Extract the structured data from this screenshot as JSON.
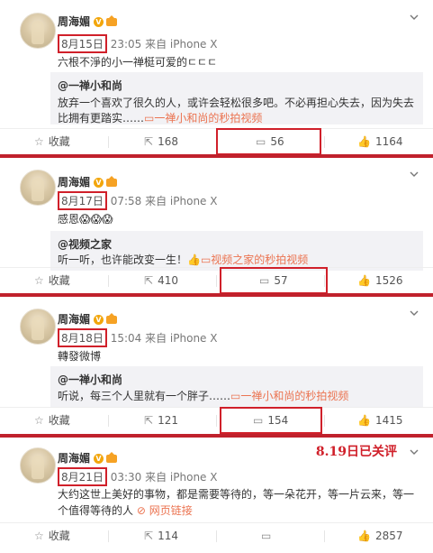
{
  "posts": [
    {
      "author": "周海媚",
      "date": "8月15日",
      "time_source": " 23:05 来自 iPhone X",
      "text": "六根不淨的小一禅梃可爱的ㄷㄷㄷ",
      "repost_author": "@一禅小和尚",
      "repost_text_1": "放弃一个喜欢了很久的人，或许会轻松很多吧。不必再担心失去，因为失去",
      "repost_text_2": "比拥有更踏实……",
      "repost_link": "一禅小和尚的秒拍视频",
      "favorite_label": "收藏",
      "repost_count": "168",
      "comment_count": "56",
      "like_count": "1164"
    },
    {
      "author": "周海媚",
      "date": "8月17日",
      "time_source": " 07:58 来自 iPhone X",
      "text": "感恩😱😱😱",
      "repost_author": "@视频之家",
      "repost_text_1": "听一听，也许能改变一生！👍",
      "repost_link": "视频之家的秒拍视频",
      "favorite_label": "收藏",
      "repost_count": "410",
      "comment_count": "57",
      "like_count": "1526"
    },
    {
      "author": "周海媚",
      "date": "8月18日",
      "time_source": " 15:04 来自 iPhone X",
      "text": "轉發微博",
      "repost_author": "@一禅小和尚",
      "repost_text_1": "听说，每三个人里就有一个胖子……",
      "repost_link": "一禅小和尚的秒拍视频",
      "favorite_label": "收藏",
      "repost_count": "121",
      "comment_count": "154",
      "like_count": "1415"
    },
    {
      "author": "周海媚",
      "date": "8月21日",
      "time_source": " 03:30 来自 iPhone X",
      "text_1": "大约这世上美好的事物，都是需要等待的，等一朵花开，等一片云来，等一",
      "text_2": "个值得等待的人",
      "web_link": "网页链接",
      "annotation": "8.19日已关评",
      "favorite_label": "收藏",
      "repost_count": "114",
      "comment_count": "",
      "like_count": "2857"
    }
  ],
  "icons": {
    "verified": "V",
    "dropdown": "chevron-down-icon",
    "favorite": "star-icon",
    "repost": "repost-icon",
    "comment": "comment-icon",
    "like": "thumbs-up-icon"
  },
  "colors": {
    "highlight": "#d0202a",
    "link": "#eb7350",
    "badge": "#f2a60c"
  }
}
